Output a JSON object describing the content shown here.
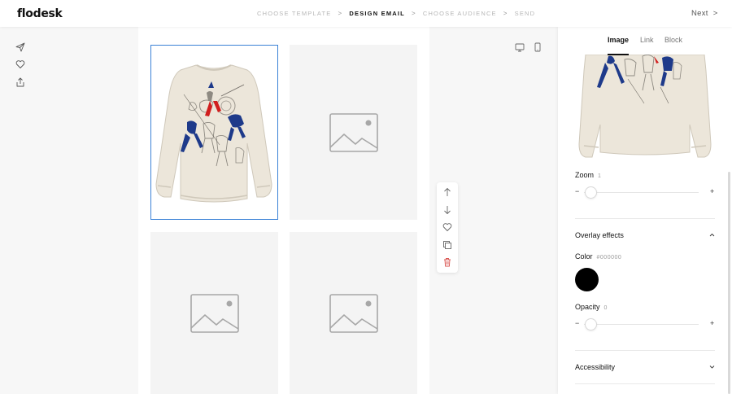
{
  "app": {
    "logo": "flodesk",
    "next_label": "Next",
    "next_chevron": ">"
  },
  "steps": [
    {
      "label": "CHOOSE TEMPLATE",
      "active": false
    },
    {
      "label": "DESIGN EMAIL",
      "active": true
    },
    {
      "label": "CHOOSE AUDIENCE",
      "active": false
    },
    {
      "label": "SEND",
      "active": false
    }
  ],
  "step_separator": ">",
  "left_rail_icons": [
    "send-icon",
    "heart-icon",
    "share-icon"
  ],
  "canvas": {
    "cells": [
      {
        "content": "sweatshirt-image",
        "selected": true
      },
      {
        "content": "image-placeholder",
        "selected": false
      },
      {
        "content": "image-placeholder",
        "selected": false
      },
      {
        "content": "image-placeholder",
        "selected": false
      }
    ]
  },
  "floating_toolbar": [
    "arrow-up-icon",
    "arrow-down-icon",
    "heart-icon",
    "duplicate-icon",
    "trash-icon"
  ],
  "device_toggle": [
    "desktop-icon",
    "mobile-icon"
  ],
  "panel": {
    "tabs": [
      {
        "label": "Image",
        "active": true
      },
      {
        "label": "Link",
        "active": false
      },
      {
        "label": "Block",
        "active": false
      }
    ],
    "zoom": {
      "label": "Zoom",
      "value": "1",
      "minus": "−",
      "plus": "+"
    },
    "overlay": {
      "label": "Overlay effects",
      "expanded": true
    },
    "color": {
      "label": "Color",
      "value": "#000000"
    },
    "opacity": {
      "label": "Opacity",
      "value": "0",
      "minus": "−",
      "plus": "+"
    },
    "accessibility": {
      "label": "Accessibility",
      "expanded": false
    }
  },
  "colors": {
    "selection": "#3b82d6",
    "trash": "#d9534f",
    "swatch": "#000000"
  }
}
